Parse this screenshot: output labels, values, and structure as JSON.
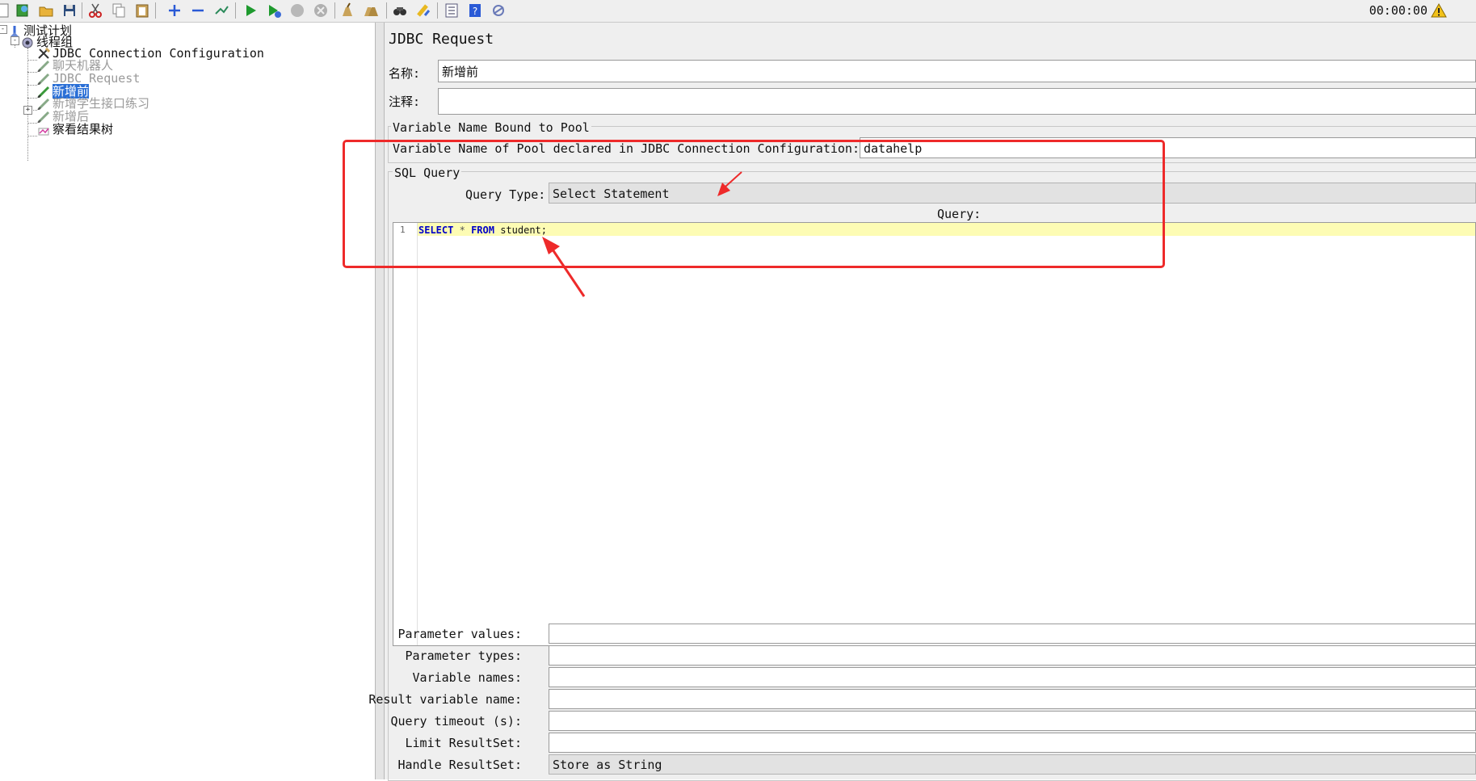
{
  "toolbar": {
    "icons": [
      "new-icon",
      "templates-icon",
      "open-icon",
      "save-icon",
      "cut-icon",
      "copy-icon",
      "paste-icon",
      "expand-icon",
      "collapse-icon",
      "toggle-icon",
      "start-icon",
      "start-no-pause-icon",
      "stop-icon",
      "shutdown-icon",
      "clear-icon",
      "clear-all-icon",
      "search-icon",
      "reset-search-icon",
      "function-helper-icon",
      "help-icon",
      "remote-icon"
    ],
    "timer": "00:00:00",
    "warning_icon": "warning-icon"
  },
  "tree": {
    "nodes": [
      {
        "label": "测试计划",
        "icon": "test-plan-icon",
        "state": "normal"
      },
      {
        "label": "线程组",
        "icon": "thread-group-icon",
        "state": "normal"
      },
      {
        "label": "JDBC Connection Configuration",
        "icon": "config-element-icon",
        "state": "normal"
      },
      {
        "label": "聊天机器人",
        "icon": "sampler-icon",
        "state": "disabled"
      },
      {
        "label": "JDBC Request",
        "icon": "sampler-icon",
        "state": "disabled"
      },
      {
        "label": "新增前",
        "icon": "sampler-icon",
        "state": "selected"
      },
      {
        "label": "新增学生接口练习",
        "icon": "sampler-icon",
        "state": "disabled"
      },
      {
        "label": "新增后",
        "icon": "sampler-icon",
        "state": "disabled"
      },
      {
        "label": "察看结果树",
        "icon": "listener-icon",
        "state": "normal"
      }
    ]
  },
  "panel": {
    "title": "JDBC Request",
    "name_label": "名称:",
    "name_value": "新增前",
    "comment_label": "注释:",
    "comment_value": "",
    "pool_group_title": "Variable Name Bound to Pool",
    "pool_label": "Variable Name of Pool declared in JDBC Connection Configuration:",
    "pool_value": "datahelp",
    "sql_group_title": "SQL Query",
    "query_type_label": "Query Type:",
    "query_type_value": "Select Statement",
    "query_label": "Query:",
    "editor": {
      "line_number": "1",
      "kw_select": "SELECT",
      "star": "*",
      "kw_from": "FROM",
      "rest": "student;"
    },
    "params": [
      {
        "label": "Parameter values:",
        "value": ""
      },
      {
        "label": "Parameter types:",
        "value": ""
      },
      {
        "label": "Variable names:",
        "value": ""
      },
      {
        "label": "Result variable name:",
        "value": ""
      },
      {
        "label": "Query timeout (s):",
        "value": ""
      },
      {
        "label": "Limit ResultSet:",
        "value": ""
      }
    ],
    "handle_label": "Handle ResultSet:",
    "handle_value": "Store as String"
  },
  "colors": {
    "annotation_red": "#ee2a2a",
    "selection_blue": "#2a6fd6",
    "line_highlight": "#fdfcb4",
    "keyword_blue": "#0000c8"
  }
}
